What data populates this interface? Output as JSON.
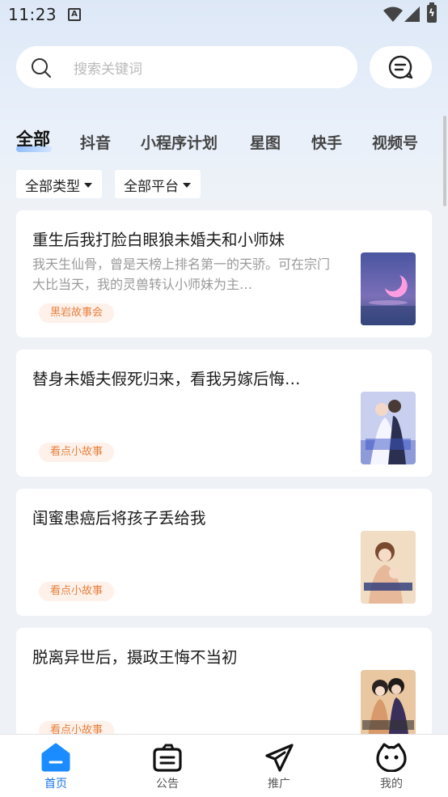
{
  "status_bar": {
    "time": "11:23",
    "notification_icon": "A"
  },
  "search": {
    "placeholder": "搜索关键词"
  },
  "tabs": [
    {
      "label": "全部",
      "active": true
    },
    {
      "label": "抖音"
    },
    {
      "label": "小程序计划"
    },
    {
      "label": "星图"
    },
    {
      "label": "快手"
    },
    {
      "label": "视频号"
    }
  ],
  "filters": {
    "type": "全部类型",
    "platform": "全部平台"
  },
  "cards": [
    {
      "title": "重生后我打脸白眼狼未婚夫和小师妹",
      "desc": "我天生仙骨，曾是天榜上排名第一的天骄。可在宗门大比当天，我的灵兽转认小师妹为主…",
      "tag": "黑岩故事会",
      "cover": "moon-night-cover"
    },
    {
      "title": "替身未婚夫假死归来，看我另嫁后悔…",
      "desc": "",
      "tag": "看点小故事",
      "cover": "wedding-couple-cover"
    },
    {
      "title": "闺蜜患癌后将孩子丢给我",
      "desc": "",
      "tag": "看点小故事",
      "cover": "mother-child-cover"
    },
    {
      "title": "脱离异世后，摄政王悔不当初",
      "desc": "",
      "tag": "看点小故事",
      "cover": "ancient-couple-cover"
    }
  ],
  "bottom_nav": [
    {
      "label": "首页",
      "icon": "home-icon",
      "active": true
    },
    {
      "label": "公告",
      "icon": "announcement-icon"
    },
    {
      "label": "推广",
      "icon": "promote-icon"
    },
    {
      "label": "我的",
      "icon": "profile-icon"
    }
  ],
  "colors": {
    "accent": "#1a73e8",
    "tag_text": "#e8803e",
    "tag_bg": "#fdf1ea"
  }
}
